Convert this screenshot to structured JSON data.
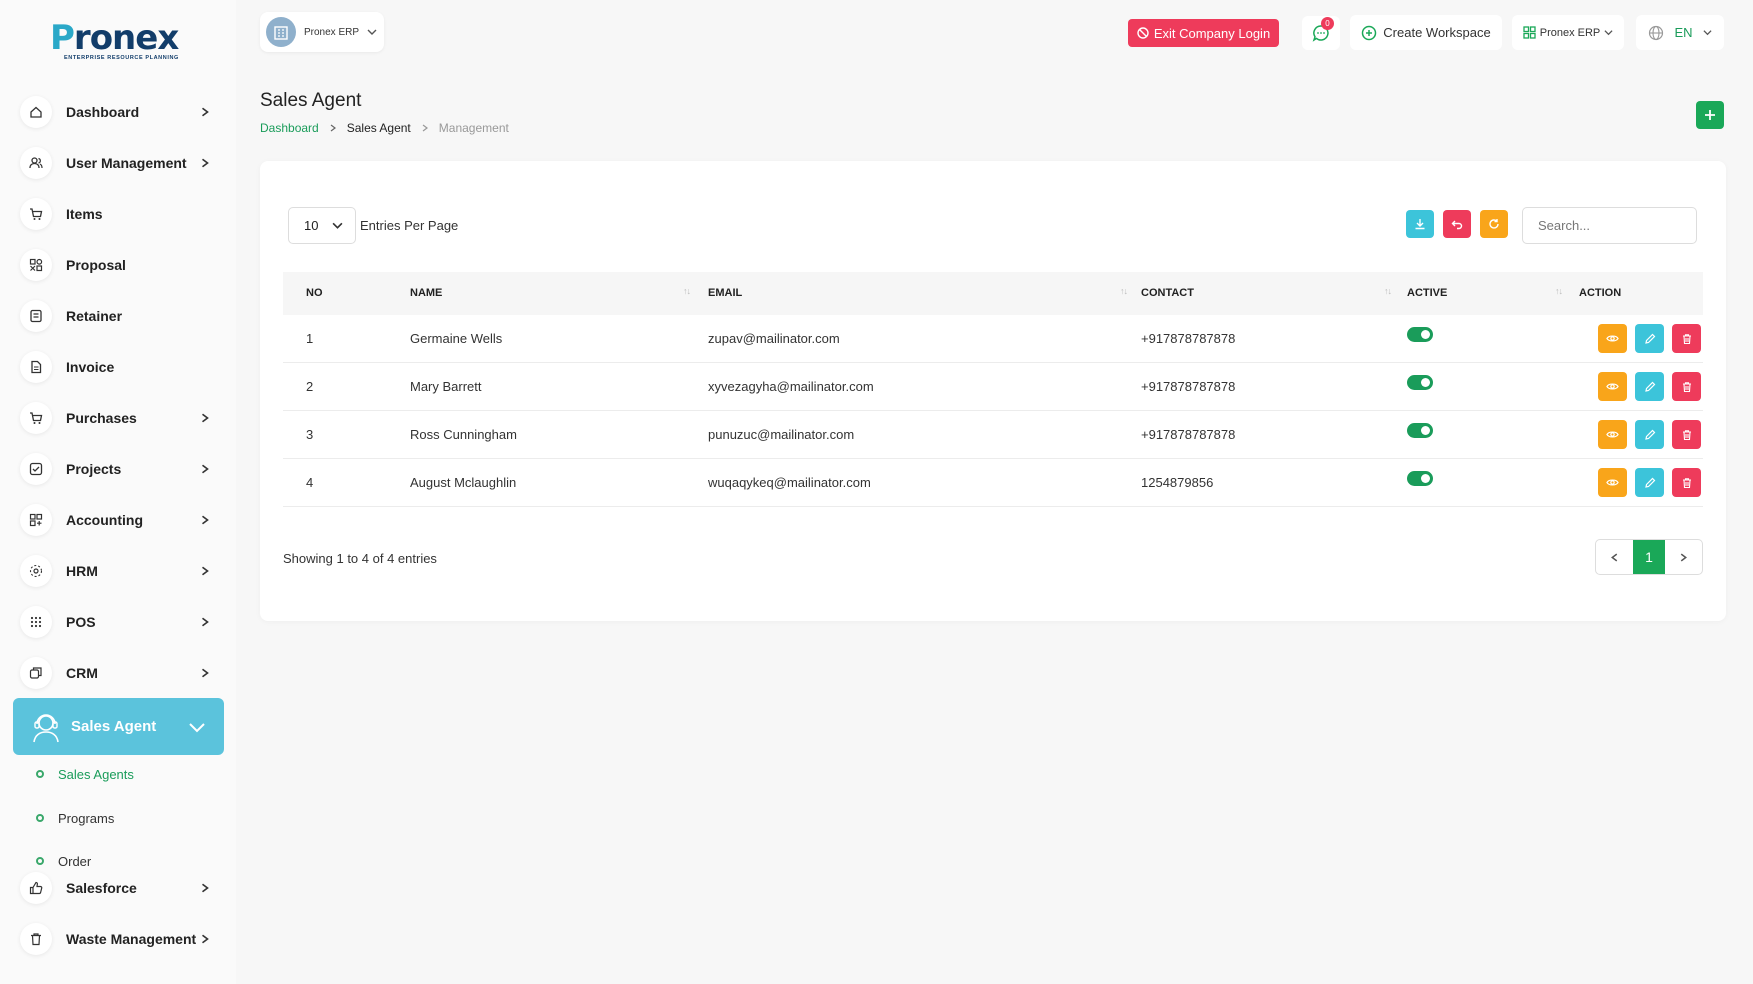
{
  "brand": {
    "logo_text": "Pronex",
    "logo_tagline": "ENTERPRISE RESOURCE PLANNING"
  },
  "sidebar": {
    "items": [
      {
        "label": "Dashboard",
        "icon": "home-icon",
        "has_chevron": true
      },
      {
        "label": "User Management",
        "icon": "users-icon",
        "has_chevron": true
      },
      {
        "label": "Items",
        "icon": "cart-icon",
        "has_chevron": false
      },
      {
        "label": "Proposal",
        "icon": "proposal-icon",
        "has_chevron": false
      },
      {
        "label": "Retainer",
        "icon": "retainer-icon",
        "has_chevron": false
      },
      {
        "label": "Invoice",
        "icon": "invoice-icon",
        "has_chevron": false
      },
      {
        "label": "Purchases",
        "icon": "cart-icon",
        "has_chevron": true
      },
      {
        "label": "Projects",
        "icon": "checklist-icon",
        "has_chevron": true
      },
      {
        "label": "Accounting",
        "icon": "grid-plus-icon",
        "has_chevron": true
      },
      {
        "label": "HRM",
        "icon": "hrm-icon",
        "has_chevron": true
      },
      {
        "label": "POS",
        "icon": "dots-grid-icon",
        "has_chevron": true
      },
      {
        "label": "CRM",
        "icon": "crm-icon",
        "has_chevron": true
      }
    ],
    "active": {
      "label": "Sales Agent",
      "icon": "headset-agent-icon"
    },
    "sub_items": [
      {
        "label": "Sales Agents",
        "active": true
      },
      {
        "label": "Programs",
        "active": false
      },
      {
        "label": "Order",
        "active": false
      }
    ],
    "bottom_items": [
      {
        "label": "Salesforce",
        "icon": "thumbs-up-icon",
        "has_chevron": true
      },
      {
        "label": "Waste Management",
        "icon": "trash-icon",
        "has_chevron": true
      }
    ]
  },
  "header": {
    "company_name": "Pronex ERP",
    "exit_label": "Exit Company Login",
    "notification_count": "0",
    "create_workspace_label": "Create Workspace",
    "workspace_select": "Pronex ERP",
    "language": "EN"
  },
  "page": {
    "title": "Sales Agent",
    "breadcrumb": [
      "Dashboard",
      "Sales Agent",
      "Management"
    ]
  },
  "table_controls": {
    "entries_value": "10",
    "entries_label": "Entries Per Page",
    "search_placeholder": "Search..."
  },
  "table": {
    "headers": [
      "NO",
      "NAME",
      "EMAIL",
      "CONTACT",
      "ACTIVE",
      "ACTION"
    ],
    "rows": [
      {
        "no": "1",
        "name": "Germaine Wells",
        "email": "zupav@mailinator.com",
        "contact": "+917878787878",
        "active": true
      },
      {
        "no": "2",
        "name": "Mary Barrett",
        "email": "xyvezagyha@mailinator.com",
        "contact": "+917878787878",
        "active": true
      },
      {
        "no": "3",
        "name": "Ross Cunningham",
        "email": "punuzuc@mailinator.com",
        "contact": "+917878787878",
        "active": true
      },
      {
        "no": "4",
        "name": "August Mclaughlin",
        "email": "wuqaqykeq@mailinator.com",
        "contact": "1254879856",
        "active": true
      }
    ]
  },
  "footer": {
    "showing_text": "Showing 1 to 4 of 4 entries",
    "current_page": "1"
  },
  "colors": {
    "accent_green": "#1aa858",
    "active_nav": "#5bc3dc",
    "danger": "#ee3b5b",
    "warning": "#f9a51a",
    "info": "#3cc4da"
  }
}
